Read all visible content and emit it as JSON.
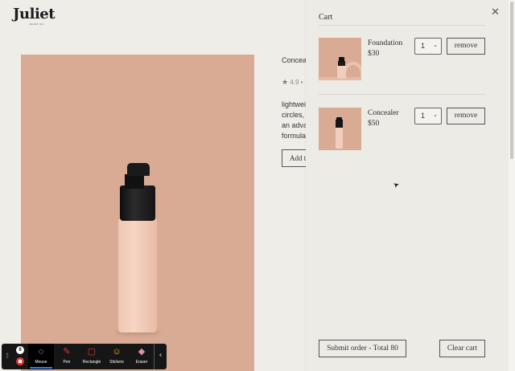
{
  "brand": {
    "logo_text": "Juliet",
    "logo_tagline": "JULIET CO."
  },
  "product": {
    "title": "Concealer",
    "rating": "4.9 •",
    "description_lines": [
      "lightweight",
      "circles,",
      "an advanced",
      "formula"
    ],
    "add_button": "Add to cart"
  },
  "cart": {
    "title": "Cart",
    "close_icon": "close-icon",
    "items": [
      {
        "name": "Foundation",
        "price": "$30",
        "qty": "1",
        "remove_label": "remove"
      },
      {
        "name": "Concealer",
        "price": "$50",
        "qty": "1",
        "remove_label": "remove"
      }
    ],
    "submit_label": "Submit order - Total 80",
    "clear_label": "Clear cart"
  },
  "recorder": {
    "tools": [
      {
        "label": "Mouse",
        "icon": "mouse-icon",
        "active": true
      },
      {
        "label": "Pen",
        "icon": "pen-icon",
        "active": false
      },
      {
        "label": "Rectangle",
        "icon": "rectangle-icon",
        "active": false
      },
      {
        "label": "Stickers",
        "icon": "sticker-icon",
        "active": false
      },
      {
        "label": "Eraser",
        "icon": "eraser-icon",
        "active": false
      }
    ]
  },
  "colors": {
    "background": "#efede7",
    "product_bg": "#d9ab95",
    "drawer_bg": "#ecebe5",
    "recorder_bg": "#161616",
    "stop_red": "#e53935",
    "active_blue": "#2d7ff9"
  }
}
